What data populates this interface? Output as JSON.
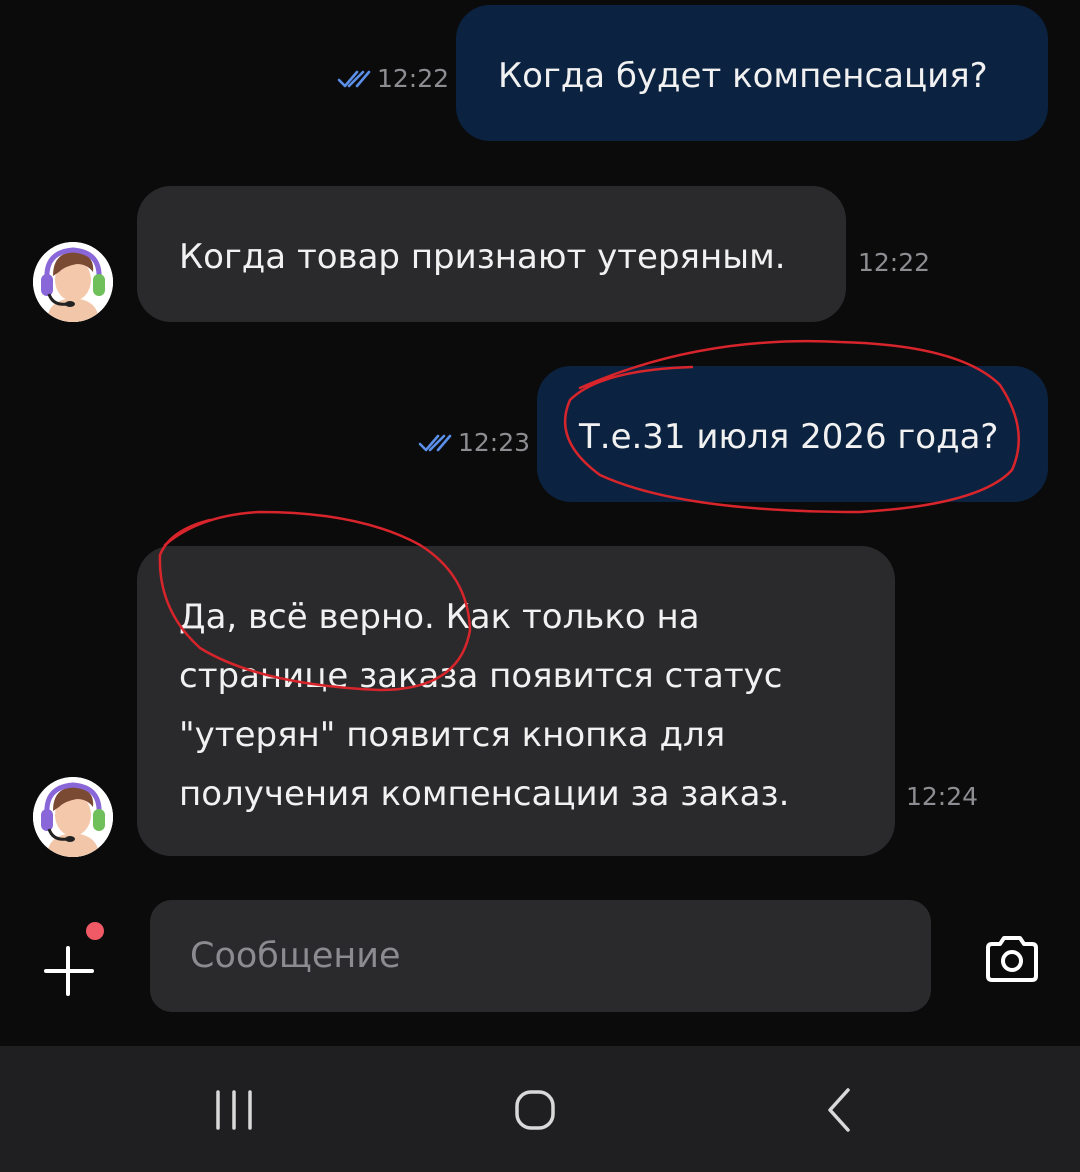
{
  "messages": [
    {
      "direction": "out",
      "text": "Когда будет компенсация?",
      "time": "12:22",
      "status_icon": "double-check-icon"
    },
    {
      "direction": "in",
      "text": "Когда товар признают утеряным.",
      "time": "12:22",
      "avatar_icon": "support-agent-avatar-icon"
    },
    {
      "direction": "out",
      "text": "Т.е.31 июля 2026 года?",
      "time": "12:23",
      "status_icon": "double-check-icon"
    },
    {
      "direction": "in",
      "text": "Да, всё верно. Как только на\nстранице заказа появится статус\n\"утерян\" появится кнопка для\nполучения компенсации за заказ.",
      "time": "12:24",
      "avatar_icon": "support-agent-avatar-icon"
    }
  ],
  "composer": {
    "placeholder": "Сообщение",
    "add_icon": "plus-icon",
    "camera_icon": "camera-icon",
    "has_notification_dot": true
  },
  "navbar": {
    "icons": [
      "recent-apps-icon",
      "home-icon",
      "back-icon"
    ]
  },
  "colors": {
    "background": "#0b0b0c",
    "outgoing_bubble": "#0b2340",
    "incoming_bubble": "#2a2a2c",
    "read_check": "#5b8fe8",
    "annotation_red": "#d8242b",
    "notification_dot": "#ef5a66"
  }
}
